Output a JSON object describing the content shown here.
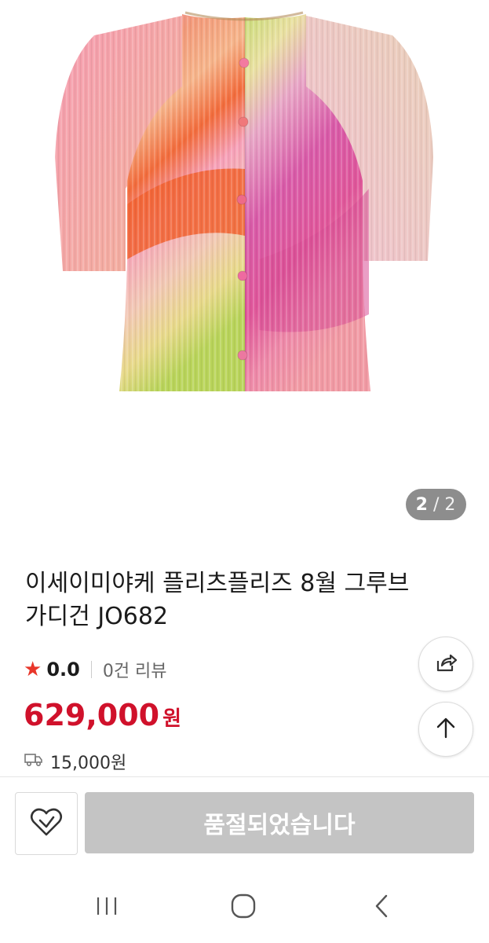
{
  "gallery": {
    "current": "2",
    "separator": "/",
    "total": "2"
  },
  "product": {
    "title": "이세이미야케 플리츠플리즈 8월 그루브 가디건 JO682",
    "rating": "0.0",
    "reviews": "0건 리뷰",
    "price": "629,000",
    "price_unit": "원",
    "shipping_fee": "15,000원"
  },
  "actions": {
    "soldout_label": "품절되었습니다"
  },
  "icons": {
    "star": "star-icon",
    "truck": "truck-icon",
    "share": "share-icon",
    "scroll_top": "arrow-up-icon",
    "wish": "heart-check-icon",
    "nav_recents": "recents-icon",
    "nav_home": "home-icon",
    "nav_back": "back-icon"
  },
  "colors": {
    "price": "#d0112b",
    "star": "#e8362a",
    "soldout_bg": "#c4c4c4"
  }
}
